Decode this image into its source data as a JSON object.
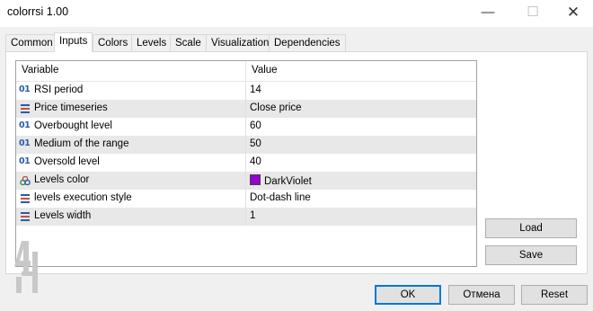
{
  "window": {
    "title": "colorrsi 1.00",
    "minimize": "—",
    "maximize": "☐",
    "close": "✕"
  },
  "tabs": [
    "Common",
    "Inputs",
    "Colors",
    "Levels",
    "Scale",
    "Visualization",
    "Dependencies"
  ],
  "active_tab": "Inputs",
  "grid": {
    "headers": {
      "variable": "Variable",
      "value": "Value"
    },
    "rows": [
      {
        "icon": "int-icon",
        "icon_text": "01",
        "name": "RSI period",
        "value": "14"
      },
      {
        "icon": "enum-icon",
        "icon_text": "",
        "name": "Price timeseries",
        "value": "Close price"
      },
      {
        "icon": "int-icon",
        "icon_text": "01",
        "name": "Overbought level",
        "value": "60"
      },
      {
        "icon": "int-icon",
        "icon_text": "01",
        "name": "Medium of the range",
        "value": "50"
      },
      {
        "icon": "int-icon",
        "icon_text": "01",
        "name": "Oversold level",
        "value": "40"
      },
      {
        "icon": "color-icon",
        "icon_text": "",
        "name": "Levels color",
        "value": "DarkViolet",
        "color": "#9400d3"
      },
      {
        "icon": "enum-icon",
        "icon_text": "",
        "name": "levels execution style",
        "value": "Dot-dash line"
      },
      {
        "icon": "enum-icon",
        "icon_text": "",
        "name": "Levels width",
        "value": "1"
      }
    ]
  },
  "side_buttons": {
    "load": "Load",
    "save": "Save"
  },
  "footer_buttons": {
    "ok": "OK",
    "cancel": "Отмена",
    "reset": "Reset"
  }
}
